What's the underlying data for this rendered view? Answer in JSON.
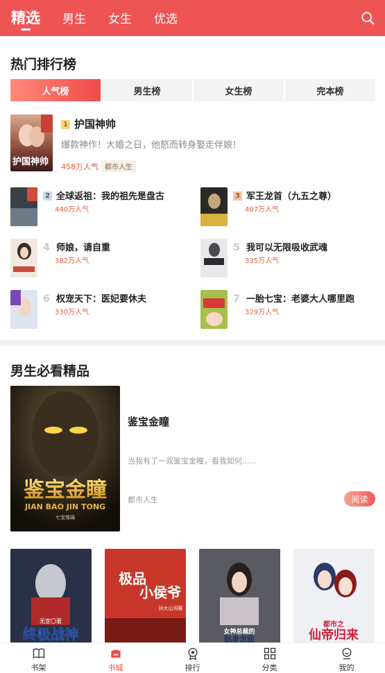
{
  "header": {
    "tabs": [
      {
        "label": "精选",
        "active": true
      },
      {
        "label": "男生",
        "active": false
      },
      {
        "label": "女生",
        "active": false
      },
      {
        "label": "优选",
        "active": false
      }
    ],
    "search_icon": "search-icon"
  },
  "hot_ranking": {
    "title": "热门排行榜",
    "tabs": [
      "人气榜",
      "男生榜",
      "女生榜",
      "完本榜"
    ],
    "active_tab": 0,
    "top_book": {
      "rank": "1",
      "title": "护国神帅",
      "description": "爆款神作！大婚之日，他怒而转身娶走伴娘！",
      "popularity": "458万人气",
      "tag": "都市人生"
    },
    "items": [
      {
        "rank": "2",
        "title": "全球返祖：我的祖先是盘古",
        "popularity": "440万人气"
      },
      {
        "rank": "3",
        "title": "军王龙首（九五之尊）",
        "popularity": "407万人气"
      },
      {
        "rank": "4",
        "title": "师娘，请自重",
        "popularity": "382万人气"
      },
      {
        "rank": "5",
        "title": "我可以无限吸收武魂",
        "popularity": "335万人气"
      },
      {
        "rank": "6",
        "title": "权宠天下：医妃要休夫",
        "popularity": "330万人气"
      },
      {
        "rank": "7",
        "title": "一胎七宝：老婆大人哪里跑",
        "popularity": "329万人气"
      }
    ]
  },
  "male_picks": {
    "title": "男生必看精品",
    "featured": {
      "title": "鉴宝金瞳",
      "description": "当我有了一双鉴宝金瞳，看我如何......",
      "category": "都市人生",
      "read_label": "阅读",
      "cover_title": "鉴宝金瞳",
      "cover_subtitle": "JIAN BAO JIN TONG",
      "cover_author": "七宝琉璃"
    },
    "grid_covers": [
      {
        "cover_text": "终极战神",
        "author": "无宜〇著"
      },
      {
        "cover_text": "极品小侯爷",
        "author": "孙大山河著"
      },
      {
        "cover_text": "女神总裁的贴身龙医",
        "author": ""
      },
      {
        "cover_text": "都市之仙帝归来",
        "author": ""
      }
    ]
  },
  "bottom_nav": [
    {
      "label": "书架",
      "icon": "book-icon",
      "active": false
    },
    {
      "label": "书城",
      "icon": "bookstore-icon",
      "active": true
    },
    {
      "label": "排行",
      "icon": "medal-icon",
      "active": false
    },
    {
      "label": "分类",
      "icon": "grid-icon",
      "active": false
    },
    {
      "label": "我的",
      "icon": "profile-icon",
      "active": false
    }
  ],
  "colors": {
    "brand": "#ef5454",
    "accent": "#ef4a4a",
    "popularity": "#e85a3a"
  }
}
